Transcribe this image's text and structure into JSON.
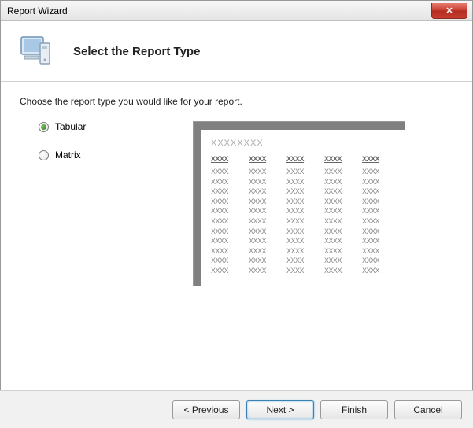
{
  "window": {
    "title": "Report Wizard",
    "close_glyph": "✕"
  },
  "header": {
    "title": "Select the Report Type"
  },
  "content": {
    "instruction": "Choose the report type you would like for your report.",
    "options": [
      {
        "label": "Tabular",
        "selected": true
      },
      {
        "label": "Matrix",
        "selected": false
      }
    ]
  },
  "footer": {
    "previous": "< Previous",
    "next": "Next >",
    "finish": "Finish",
    "cancel": "Cancel"
  }
}
